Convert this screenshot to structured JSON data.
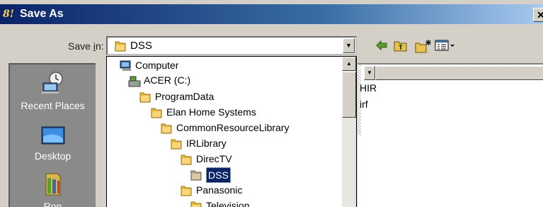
{
  "window": {
    "title": "Save As",
    "app_icon_text": "8!",
    "close_glyph": "✕"
  },
  "toolbar": {
    "save_in_label_prefix": "Save ",
    "save_in_label_accel": "i",
    "save_in_label_suffix": "n:",
    "current_folder": "DSS",
    "back_icon": "arrow-left-icon",
    "up_icon": "up-folder-icon",
    "new_folder_icon": "new-folder-icon",
    "views_icon": "views-menu-icon"
  },
  "places": [
    {
      "label": "Recent Places",
      "icon": "recent-places-icon"
    },
    {
      "label": "Desktop",
      "icon": "desktop-icon"
    },
    {
      "label": "Ron",
      "icon": "user-library-icon"
    }
  ],
  "tree": [
    {
      "label": "Computer",
      "icon": "computer-icon",
      "level": 0
    },
    {
      "label": "ACER (C:)",
      "icon": "drive-icon",
      "level": 1
    },
    {
      "label": "ProgramData",
      "icon": "folder-icon",
      "level": 2
    },
    {
      "label": "Elan Home Systems",
      "icon": "folder-icon",
      "level": 3
    },
    {
      "label": "CommonResourceLibrary",
      "icon": "folder-icon",
      "level": 4
    },
    {
      "label": "IRLibrary",
      "icon": "folder-icon",
      "level": 5
    },
    {
      "label": "DirecTV",
      "icon": "folder-icon",
      "level": 6
    },
    {
      "label": "DSS",
      "icon": "folder-open-icon",
      "level": 7,
      "selected": true
    },
    {
      "label": "Panasonic",
      "icon": "folder-icon",
      "level": 6
    },
    {
      "label": "Television",
      "icon": "folder-icon",
      "level": 7
    }
  ],
  "files": [
    {
      "name": "HIR"
    },
    {
      "name": "irf"
    }
  ]
}
